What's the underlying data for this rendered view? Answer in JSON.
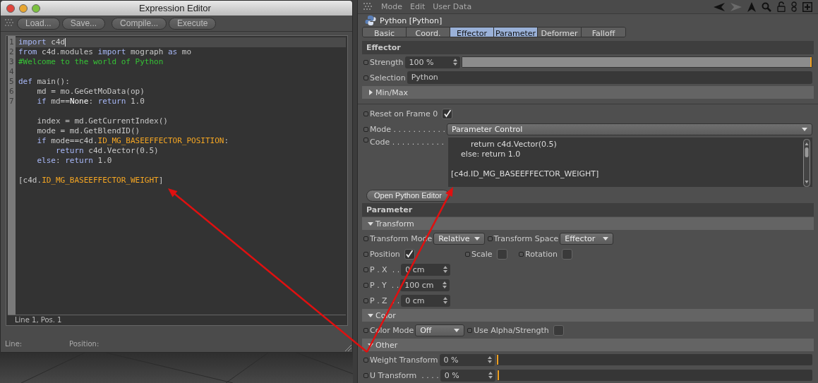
{
  "editor_window": {
    "title": "Expression Editor",
    "buttons": [
      "Load...",
      "Save...",
      "Compile...",
      "Execute"
    ],
    "lines": [
      {
        "kind": "code",
        "number": "1",
        "current": true,
        "tokens": [
          {
            "kind": "keyword",
            "text": "import"
          },
          {
            "kind": "plain",
            "text": " c4d"
          }
        ]
      },
      {
        "kind": "code",
        "number": "2",
        "current": false,
        "tokens": [
          {
            "kind": "keyword",
            "text": "from"
          },
          {
            "kind": "plain",
            "text": " c4d.modules "
          },
          {
            "kind": "keyword",
            "text": "import"
          },
          {
            "kind": "plain",
            "text": " mograph "
          },
          {
            "kind": "keyword",
            "text": "as"
          },
          {
            "kind": "plain",
            "text": " mo"
          }
        ]
      },
      {
        "kind": "code",
        "number": "3",
        "current": false,
        "tokens": [
          {
            "kind": "comment",
            "text": "#Welcome to the world of Python"
          }
        ]
      },
      {
        "kind": "blank",
        "number": "4",
        "current": false
      },
      {
        "kind": "code",
        "number": "5",
        "current": false,
        "tokens": [
          {
            "kind": "keyword",
            "text": "def"
          },
          {
            "kind": "plain",
            "text": " main():"
          }
        ]
      },
      {
        "kind": "code",
        "number": "6",
        "current": false,
        "tokens": [
          {
            "kind": "plain",
            "text": "    md = mo.GeGetMoData(op)"
          }
        ]
      },
      {
        "kind": "code",
        "number": "7",
        "current": false,
        "tokens": [
          {
            "kind": "keyword",
            "text": "    if"
          },
          {
            "kind": "plain",
            "text": " md=="
          },
          {
            "kind": "builtin",
            "text": "None"
          },
          {
            "kind": "plain",
            "text": ": "
          },
          {
            "kind": "keyword",
            "text": "return"
          },
          {
            "kind": "plain",
            "text": " 1.0"
          }
        ]
      },
      {
        "kind": "blank",
        "current": false
      },
      {
        "kind": "code",
        "current": false,
        "tokens": [
          {
            "kind": "plain",
            "text": "    index = md.GetCurrentIndex()"
          }
        ]
      },
      {
        "kind": "code",
        "current": false,
        "tokens": [
          {
            "kind": "plain",
            "text": "    mode = md.GetBlendID()"
          }
        ]
      },
      {
        "kind": "code",
        "current": false,
        "tokens": [
          {
            "kind": "keyword",
            "text": "    if"
          },
          {
            "kind": "plain",
            "text": " mode==c4d."
          },
          {
            "kind": "constant",
            "text": "ID_MG_BASEEFFECTOR_POSITION"
          },
          {
            "kind": "plain",
            "text": ":"
          }
        ]
      },
      {
        "kind": "code",
        "current": false,
        "tokens": [
          {
            "kind": "keyword",
            "text": "        return"
          },
          {
            "kind": "plain",
            "text": " c4d.Vector(0.5)"
          }
        ]
      },
      {
        "kind": "code",
        "current": false,
        "tokens": [
          {
            "kind": "keyword",
            "text": "    else"
          },
          {
            "kind": "plain",
            "text": ": "
          },
          {
            "kind": "keyword",
            "text": "return"
          },
          {
            "kind": "plain",
            "text": " 1.0"
          }
        ]
      },
      {
        "kind": "blank",
        "current": false
      },
      {
        "kind": "code",
        "current": false,
        "tokens": [
          {
            "kind": "plain",
            "text": "[c4d."
          },
          {
            "kind": "constant",
            "text": "ID_MG_BASEEFFECTOR_WEIGHT"
          },
          {
            "kind": "plain",
            "text": "]"
          }
        ]
      }
    ],
    "cursor_status": "Line 1, Pos. 1",
    "footer": [
      "Line:",
      "Position:"
    ]
  },
  "attributes": {
    "menu": [
      "Mode",
      "Edit",
      "User Data"
    ],
    "object_title": "Python [Python]",
    "tabs": [
      {
        "label": "Basic",
        "selected": false
      },
      {
        "label": "Coord.",
        "selected": false
      },
      {
        "label": "Effector",
        "selected": true
      },
      {
        "label": "Parameter",
        "selected": true
      },
      {
        "label": "Deformer",
        "selected": false
      },
      {
        "label": "Falloff",
        "selected": false
      }
    ],
    "sections": [
      {
        "kind": "header",
        "title": "Effector"
      },
      {
        "kind": "row",
        "controls": [
          {
            "kind": "slider",
            "label": "Strength",
            "value": "100 %",
            "level": 1.0
          }
        ]
      },
      {
        "kind": "row",
        "controls": [
          {
            "kind": "text",
            "label": "Selection",
            "value": "Python"
          }
        ]
      },
      {
        "kind": "group",
        "title": "Min/Max",
        "expanded": false
      },
      {
        "kind": "gap"
      },
      {
        "kind": "row",
        "controls": [
          {
            "kind": "check",
            "label": "Reset on Frame 0",
            "checked": true
          }
        ]
      },
      {
        "kind": "row",
        "controls": [
          {
            "kind": "dropdown",
            "label": "Mode . . . . . . . . . . .",
            "value": "Parameter Control"
          }
        ]
      },
      {
        "kind": "row",
        "controls": [
          {
            "kind": "code",
            "label": "Code . . . . . . . . . . .",
            "lines": [
              {
                "kind": "text",
                "text": "        return c4d.Vector(0.5)"
              },
              {
                "kind": "text",
                "text": "    else: return 1.0"
              },
              {
                "kind": "blank"
              },
              {
                "kind": "text",
                "text": "[c4d.ID_MG_BASEEFFECTOR_WEIGHT]"
              }
            ]
          }
        ]
      },
      {
        "kind": "row",
        "controls": [
          {
            "kind": "button",
            "label": "Open Python Editor"
          }
        ]
      },
      {
        "kind": "header",
        "title": "Parameter"
      },
      {
        "kind": "group",
        "title": "Transform",
        "expanded": true
      },
      {
        "kind": "row",
        "controls": [
          {
            "kind": "dropdown",
            "label": "Transform Mode",
            "value": "Relative"
          },
          {
            "kind": "dropdown",
            "label": "Transform Space",
            "value": "Effector"
          }
        ]
      },
      {
        "kind": "row",
        "controls": [
          {
            "kind": "check",
            "label": "Position",
            "checked": true
          },
          {
            "kind": "check",
            "label": "Scale",
            "checked": false
          },
          {
            "kind": "check",
            "label": "Rotation",
            "checked": false
          }
        ]
      },
      {
        "kind": "row",
        "controls": [
          {
            "kind": "number",
            "label": "P . X  . .",
            "value": "0 cm"
          }
        ]
      },
      {
        "kind": "row",
        "controls": [
          {
            "kind": "number",
            "label": "P . Y  . .",
            "value": "100 cm"
          }
        ]
      },
      {
        "kind": "row",
        "controls": [
          {
            "kind": "number",
            "label": "P . Z  . .",
            "value": "0 cm"
          }
        ]
      },
      {
        "kind": "group",
        "title": "Color",
        "expanded": true
      },
      {
        "kind": "row",
        "controls": [
          {
            "kind": "dropdown",
            "label": "Color Mode",
            "value": "Off"
          },
          {
            "kind": "check",
            "label": "Use Alpha/Strength",
            "checked": false
          }
        ]
      },
      {
        "kind": "group",
        "title": "Other",
        "expanded": true
      },
      {
        "kind": "row",
        "controls": [
          {
            "kind": "slider",
            "label": "Weight Transform",
            "value": "0 %",
            "level": 0
          }
        ]
      },
      {
        "kind": "row",
        "controls": [
          {
            "kind": "slider",
            "label": "U Transform  . . . .",
            "value": "0 %",
            "level": 0
          }
        ]
      }
    ]
  }
}
